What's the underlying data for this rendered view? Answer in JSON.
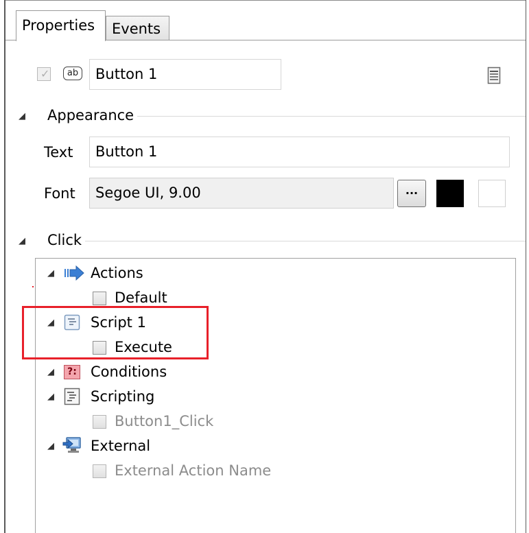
{
  "tabs": [
    {
      "label": "Properties",
      "active": true
    },
    {
      "label": "Events",
      "active": false
    }
  ],
  "header": {
    "enabled_checked": true,
    "type_icon": "ab-text-icon",
    "name_value": "Button 1",
    "page_icon": "properties-page-icon"
  },
  "appearance": {
    "section_label": "Appearance",
    "text_label": "Text",
    "text_value": "Button 1",
    "font_label": "Font",
    "font_value": "Segoe UI, 9.00",
    "font_button_label": "...",
    "foreground_color": "#000000",
    "background_color": "#ffffff"
  },
  "click": {
    "section_label": "Click",
    "tree": [
      {
        "label": "Actions",
        "icon": "blue-arrow-icon",
        "child": {
          "label": "Default",
          "checked": false,
          "dim": false
        }
      },
      {
        "label": "Script 1",
        "icon": "script-icon",
        "child": {
          "label": "Execute",
          "checked": false,
          "dim": false
        },
        "highlighted": true
      },
      {
        "label": "Conditions",
        "icon": "condition-icon",
        "icon_text": "?:",
        "child": null
      },
      {
        "label": "Scripting",
        "icon": "scripting-icon",
        "child": {
          "label": "Button1_Click",
          "checked": false,
          "dim": true
        }
      },
      {
        "label": "External",
        "icon": "external-icon",
        "child": {
          "label": "External Action Name",
          "checked": false,
          "dim": true
        }
      }
    ]
  },
  "colors": {
    "highlight": "#e8202a",
    "accent_blue": "#3b7fd4",
    "condition_pink": "#f4a5ad"
  }
}
